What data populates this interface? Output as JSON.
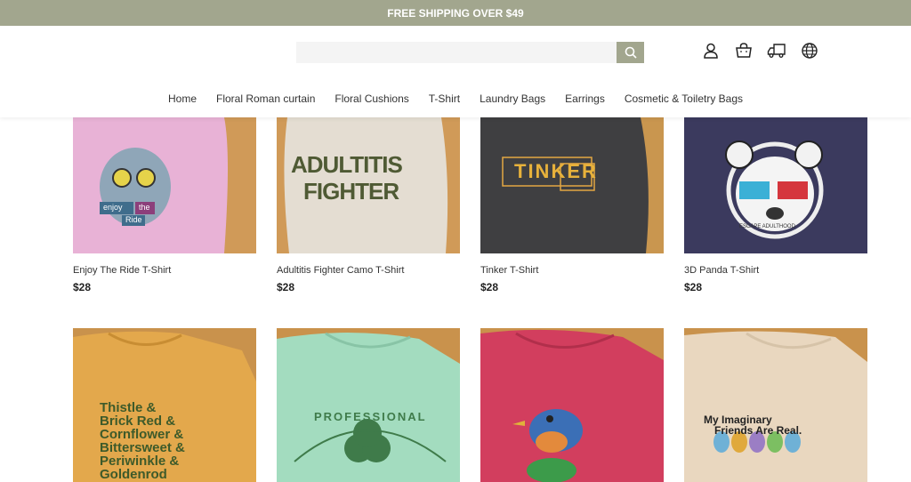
{
  "announcement": "FREE SHIPPING OVER $49",
  "search": {
    "placeholder": ""
  },
  "header_icons": [
    "account-icon",
    "cart-icon",
    "shipping-icon",
    "globe-icon"
  ],
  "nav": [
    "Home",
    "Floral Roman curtain",
    "Floral Cushions",
    "T-Shirt",
    "Laundry Bags",
    "Earrings",
    "Cosmetic & Toiletry Bags"
  ],
  "products": [
    {
      "name": "Enjoy The Ride T-Shirt",
      "price": "$28",
      "shirt_color": "#e8b2d6"
    },
    {
      "name": "Adultitis Fighter Camo T-Shirt",
      "price": "$28",
      "shirt_color": "#e4ddd2"
    },
    {
      "name": "Tinker T-Shirt",
      "price": "$28",
      "shirt_color": "#3f3f41"
    },
    {
      "name": "3D Panda T-Shirt",
      "price": "$28",
      "shirt_color": "#3b3a5e"
    },
    {
      "name": "",
      "price": "",
      "shirt_color": "#e3a84c"
    },
    {
      "name": "",
      "price": "",
      "shirt_color": "#a3dcbf"
    },
    {
      "name": "",
      "price": "",
      "shirt_color": "#d23e5e"
    },
    {
      "name": "",
      "price": "",
      "shirt_color": "#e9d7bf"
    }
  ],
  "artwork": {
    "adultitis": [
      "ADULTITIS",
      "FIGHTER"
    ],
    "tinker": "TINKER",
    "panda": "ESCAPE ADULTHOOD",
    "colors_list": [
      "Thistle &",
      "Brick Red &",
      "Cornflower &",
      "Bittersweet &",
      "Periwinkle &",
      "Goldenrod"
    ],
    "professional": "PROFESSIONAL",
    "imaginary": [
      "My Imaginary",
      "Friends Are Real."
    ],
    "enjoy": [
      "enjoy",
      "the",
      "Ride"
    ]
  },
  "colors": {
    "accent": "#a2a68e"
  }
}
